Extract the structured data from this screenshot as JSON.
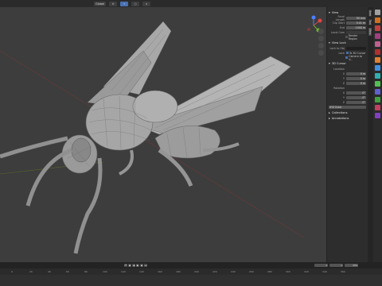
{
  "topbar": {
    "view_label": "Global",
    "buttons": [
      "Global",
      "",
      "",
      "",
      ""
    ]
  },
  "npanel": {
    "view_header": "View",
    "focal_label": "Focal Length",
    "focal_value": "50 mm",
    "clip_start_label": "Clip Start",
    "clip_start_value": "0.01 m",
    "clip_end_label": "End",
    "clip_end_value": "1000 m",
    "local_camera_label": "Local Cam",
    "render_region_label": "Render Region",
    "view_lock_header": "View Lock",
    "lock_object_label": "Lock to Obj",
    "lock_label": "Lock",
    "lock_3d_cursor": "To 3D Cursor",
    "camera_to_view": "Camera to V...",
    "cursor_header": "3D Cursor",
    "location_label": "Location",
    "loc_x": "0 m",
    "loc_y": "0 m",
    "loc_z": "0 m",
    "rotation_label": "Rotation",
    "rot_x": "0°",
    "rot_y": "0°",
    "rot_z": "0°",
    "mode_value": "XYZ Euler",
    "collections_header": "Collections",
    "annotations_header": "Annotations"
  },
  "sidetabs": [
    "Item",
    "Tool",
    "View"
  ],
  "timeline": {
    "frame_current": "1",
    "frame_start": "1",
    "frame_end": "250",
    "ruler": [
      "0",
      "20",
      "40",
      "60",
      "80",
      "100",
      "120",
      "140",
      "160",
      "180",
      "200",
      "220",
      "240",
      "260",
      "280",
      "300",
      "320",
      "340",
      "360"
    ]
  }
}
